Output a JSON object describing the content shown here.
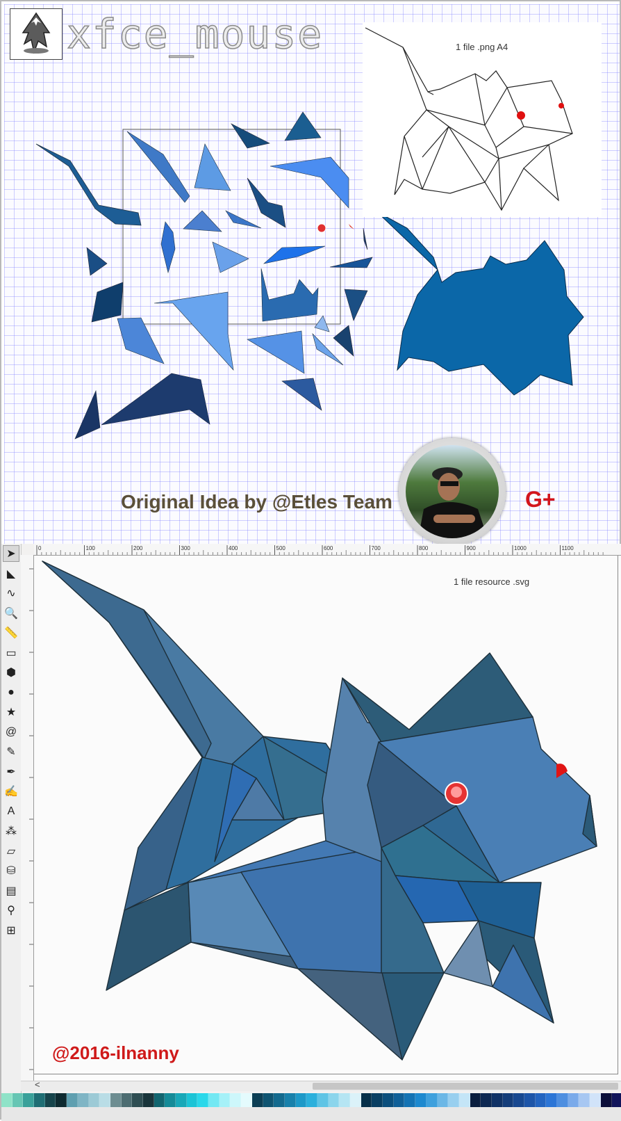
{
  "poster": {
    "title": "xfce_mouse",
    "png_caption": "1 file .png A4",
    "credit": "Original Idea by @Etles Team",
    "social": "G+"
  },
  "editor": {
    "svg_caption": "1 file resource .svg",
    "watermark": "@2016-ilnanny",
    "ruler_ticks": [
      "0",
      "100",
      "200",
      "300",
      "400",
      "500",
      "600",
      "700",
      "800",
      "900",
      "1000",
      "1100"
    ],
    "scroll_left_glyph": "<",
    "tools": [
      {
        "name": "selector-tool",
        "glyph": "➤"
      },
      {
        "name": "node-tool",
        "glyph": "◣"
      },
      {
        "name": "tweak-tool",
        "glyph": "∿"
      },
      {
        "name": "zoom-tool",
        "glyph": "🔍"
      },
      {
        "name": "measure-tool",
        "glyph": "📏"
      },
      {
        "name": "rect-tool",
        "glyph": "▭"
      },
      {
        "name": "3dbox-tool",
        "glyph": "⬢"
      },
      {
        "name": "ellipse-tool",
        "glyph": "●"
      },
      {
        "name": "star-tool",
        "glyph": "★"
      },
      {
        "name": "spiral-tool",
        "glyph": "@"
      },
      {
        "name": "pencil-tool",
        "glyph": "✎"
      },
      {
        "name": "pen-tool",
        "glyph": "✒"
      },
      {
        "name": "calligraphy-tool",
        "glyph": "✍"
      },
      {
        "name": "text-tool",
        "glyph": "A"
      },
      {
        "name": "spray-tool",
        "glyph": "⁂"
      },
      {
        "name": "eraser-tool",
        "glyph": "▱"
      },
      {
        "name": "bucket-tool",
        "glyph": "⛁"
      },
      {
        "name": "gradient-tool",
        "glyph": "▤"
      },
      {
        "name": "dropper-tool",
        "glyph": "⚲"
      },
      {
        "name": "connector-tool",
        "glyph": "⊞"
      }
    ]
  },
  "palette": [
    "#8fe3c8",
    "#66c6b4",
    "#3aa19a",
    "#1f6e74",
    "#16444b",
    "#0e2a30",
    "#5f9fb0",
    "#7fb5c5",
    "#9ccad6",
    "#b9dde6",
    "#6d8d91",
    "#4d6d72",
    "#2f4e53",
    "#19353b",
    "#11656f",
    "#148b98",
    "#18a8b8",
    "#1cc4d6",
    "#2ad8ea",
    "#72e8f3",
    "#a5f1f8",
    "#cdf7fb",
    "#e4fbfd",
    "#0c3f55",
    "#0f5471",
    "#136a8e",
    "#1881ab",
    "#1d99c8",
    "#2bb0dc",
    "#5fc4e5",
    "#8bd5ec",
    "#b5e5f3",
    "#dbf2f9",
    "#06304a",
    "#093f63",
    "#0c4f7d",
    "#106098",
    "#1473b4",
    "#1d89cf",
    "#3ea0dd",
    "#6bb7e6",
    "#98cfef",
    "#c4e5f7",
    "#0a1e3f",
    "#0d2852",
    "#103266",
    "#143d7a",
    "#184890",
    "#1d55a8",
    "#2364c0",
    "#2c75d6",
    "#4d8ee0",
    "#7aaaea",
    "#a7c7f2",
    "#d1e3f9",
    "#0b0e3a",
    "#10145a"
  ]
}
